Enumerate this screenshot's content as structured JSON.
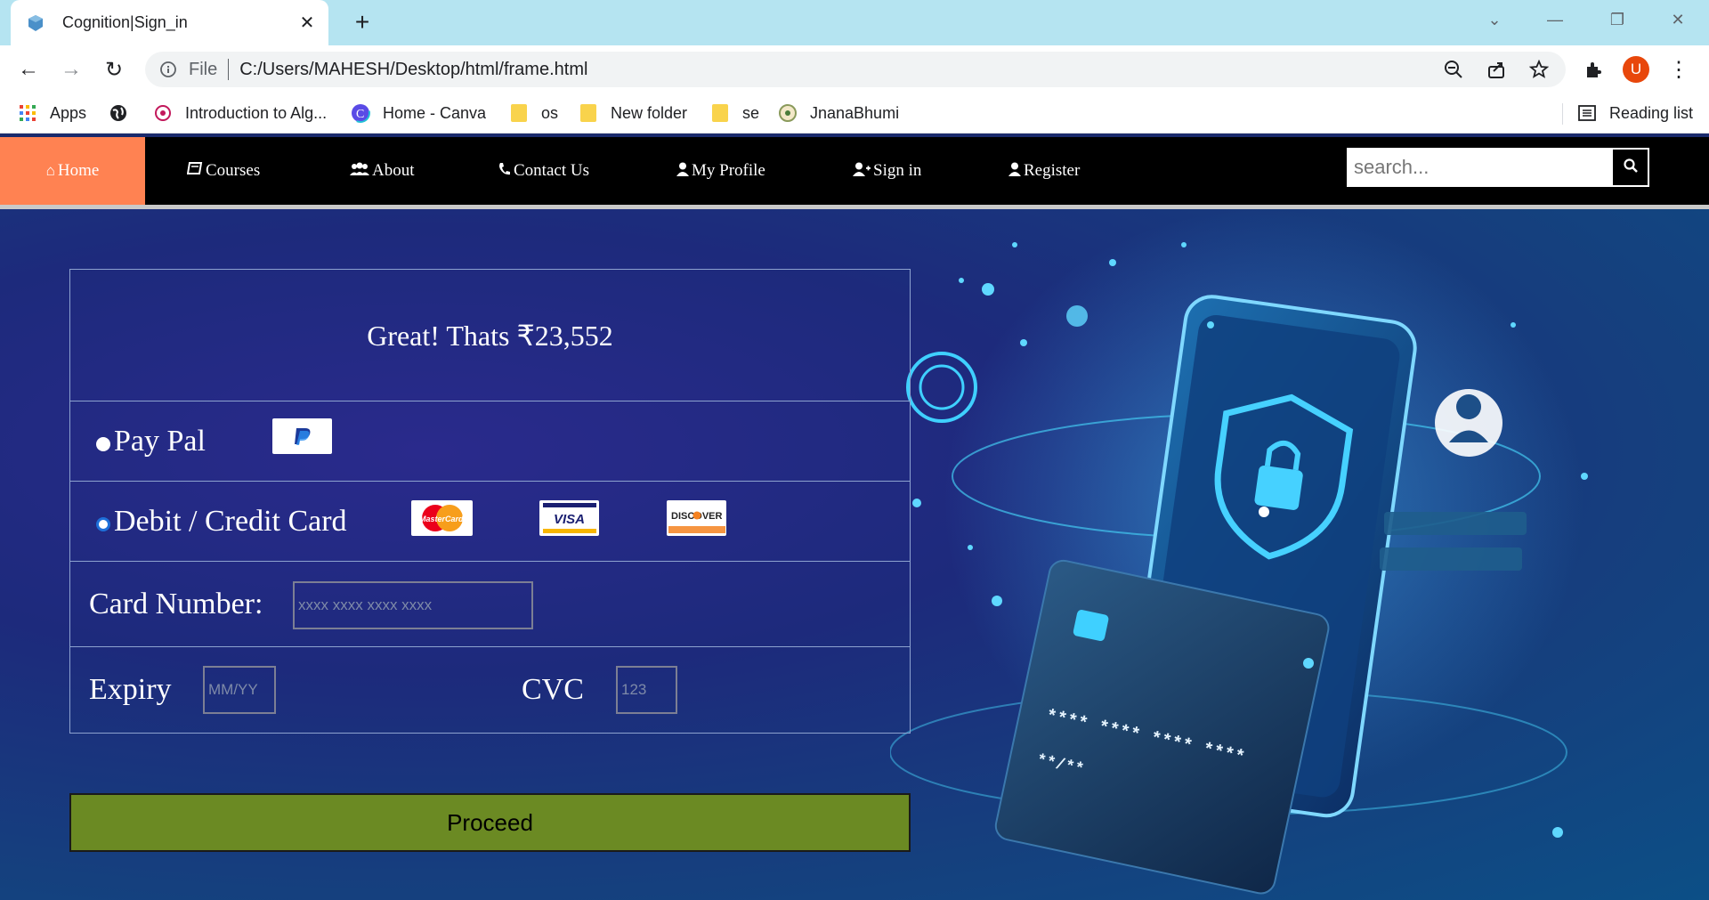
{
  "browser": {
    "tab_title": "Cognition|Sign_in",
    "url_scheme": "File",
    "url": "C:/Users/MAHESH/Desktop/html/frame.html",
    "profile_initial": "U",
    "bookmarks": [
      {
        "label": "Apps",
        "icon": "apps-grid-icon"
      },
      {
        "label": "",
        "icon": "globe-icon"
      },
      {
        "label": "Introduction to Alg...",
        "icon": "site-icon"
      },
      {
        "label": "Home - Canva",
        "icon": "canva-icon"
      },
      {
        "label": "os",
        "icon": "folder-icon"
      },
      {
        "label": "New folder",
        "icon": "folder-icon"
      },
      {
        "label": "se",
        "icon": "folder-icon"
      },
      {
        "label": "JnanaBhumi",
        "icon": "emblem-icon"
      }
    ],
    "reading_list": "Reading list"
  },
  "nav": {
    "items": [
      {
        "label": "Home",
        "icon": "home-icon"
      },
      {
        "label": " Courses",
        "icon": "book-icon"
      },
      {
        "label": "About",
        "icon": "users-icon"
      },
      {
        "label": "Contact Us",
        "icon": "phone-icon"
      },
      {
        "label": "My Profile",
        "icon": "user-icon"
      },
      {
        "label": "Sign in",
        "icon": "user-plus-icon"
      },
      {
        "label": "Register",
        "icon": "user-icon"
      }
    ],
    "search_placeholder": "search...",
    "accent_color": "#ff8252"
  },
  "payment": {
    "total_text": "Great! Thats ₹23,552",
    "paypal_label": "Pay Pal",
    "card_label": "Debit / Credit Card",
    "card_logos": [
      "MasterCard",
      "VISA",
      "DISCOVER"
    ],
    "card_number_label": "Card Number:",
    "card_number_placeholder": "xxxx xxxx xxxx xxxx",
    "expiry_label": "Expiry",
    "expiry_placeholder": "MM/YY",
    "cvc_label": "CVC",
    "cvc_placeholder": "123",
    "proceed_label": "Proceed",
    "proceed_color": "#6b8a23"
  }
}
